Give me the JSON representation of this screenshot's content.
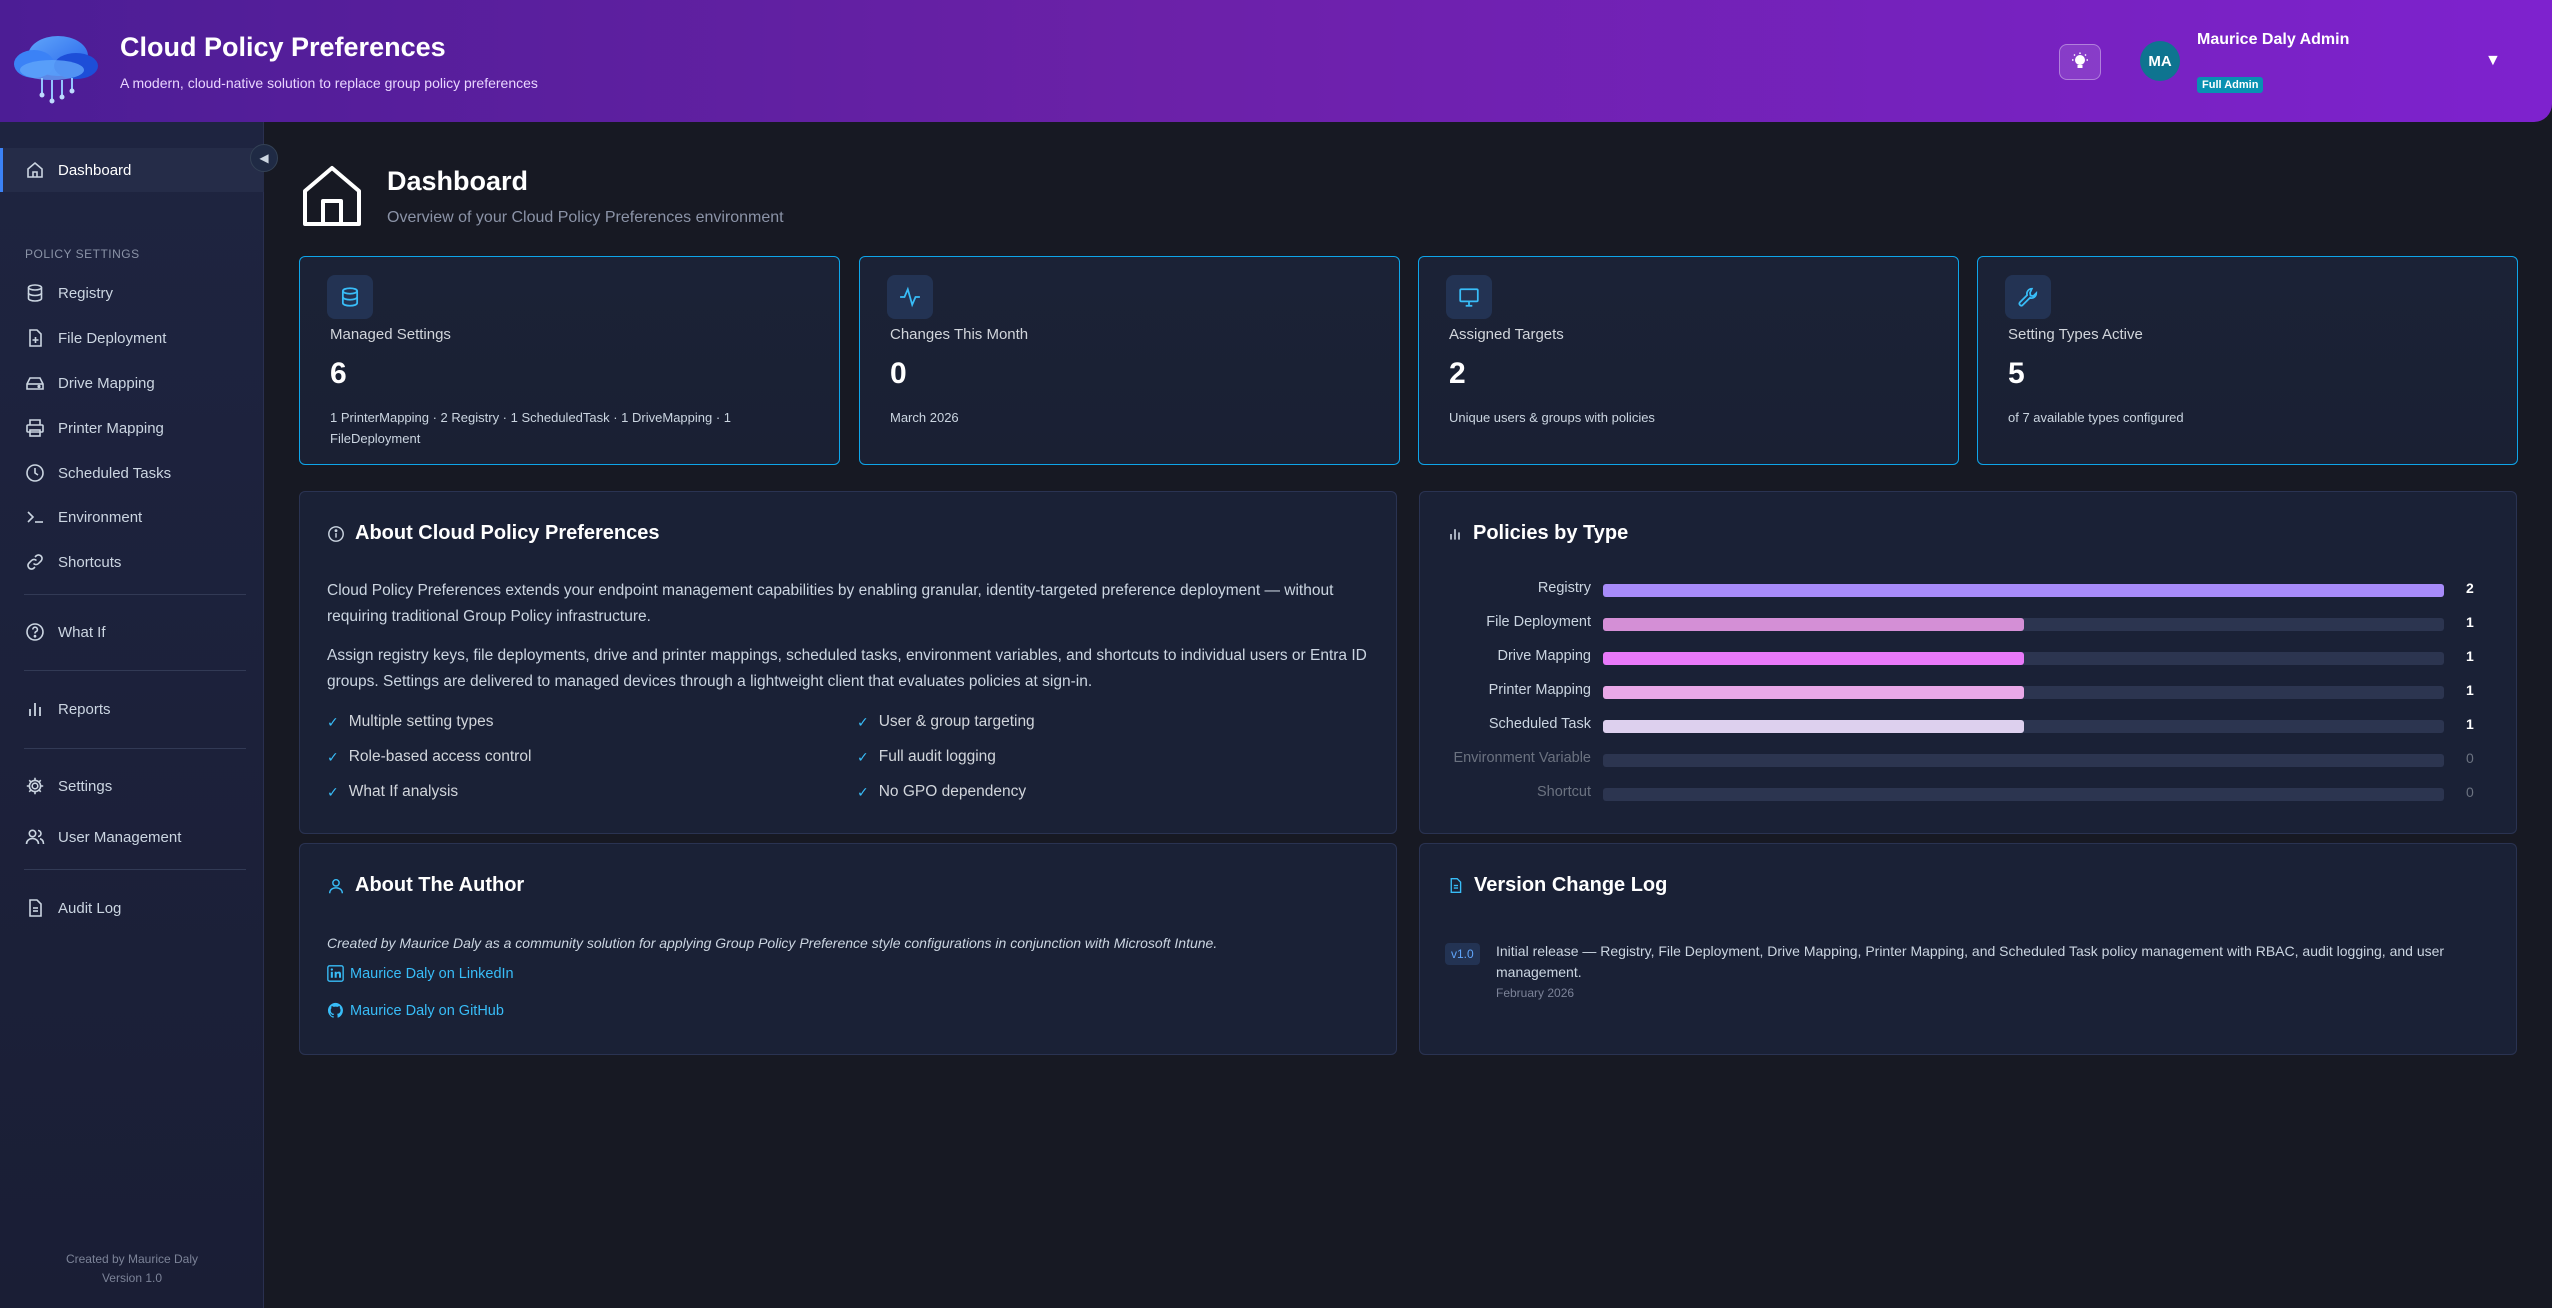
{
  "header": {
    "title": "Cloud Policy Preferences",
    "subtitle": "A modern, cloud-native solution to replace group policy preferences",
    "user_initials": "MA",
    "user_name": "Maurice Daly Admin",
    "user_role": "Full Admin"
  },
  "sidebar": {
    "dashboard": "Dashboard",
    "section_label": "POLICY SETTINGS",
    "items": [
      "Registry",
      "File Deployment",
      "Drive Mapping",
      "Printer Mapping",
      "Scheduled Tasks",
      "Environment",
      "Shortcuts"
    ],
    "what_if": "What If",
    "reports": "Reports",
    "settings": "Settings",
    "user_management": "User Management",
    "audit_log": "Audit Log",
    "footer_created": "Created by Maurice Daly",
    "footer_version": "Version 1.0"
  },
  "page": {
    "title": "Dashboard",
    "subtitle": "Overview of your Cloud Policy Preferences environment"
  },
  "stats": [
    {
      "label": "Managed Settings",
      "value": "6",
      "note": "1 PrinterMapping · 2 Registry · 1 ScheduledTask · 1 DriveMapping · 1 FileDeployment"
    },
    {
      "label": "Changes This Month",
      "value": "0",
      "note": "March 2026"
    },
    {
      "label": "Assigned Targets",
      "value": "2",
      "note": "Unique users & groups with policies"
    },
    {
      "label": "Setting Types Active",
      "value": "5",
      "note": "of 7 available types configured"
    }
  ],
  "about": {
    "title": "About Cloud Policy Preferences",
    "p1": "Cloud Policy Preferences extends your endpoint management capabilities by enabling granular, identity-targeted preference deployment — without requiring traditional Group Policy infrastructure.",
    "p2": "Assign registry keys, file deployments, drive and printer mappings, scheduled tasks, environment variables, and shortcuts to individual users or Entra ID groups. Settings are delivered to managed devices through a lightweight client that evaluates policies at sign-in.",
    "features": [
      "Multiple setting types",
      "User & group targeting",
      "Role-based access control",
      "Full audit logging",
      "What If analysis",
      "No GPO dependency"
    ]
  },
  "chart_data": {
    "type": "bar",
    "title": "Policies by Type",
    "orientation": "horizontal",
    "categories": [
      "Registry",
      "File Deployment",
      "Drive Mapping",
      "Printer Mapping",
      "Scheduled Task",
      "Environment Variable",
      "Shortcut"
    ],
    "values": [
      2,
      1,
      1,
      1,
      1,
      0,
      0
    ],
    "colors": [
      "#a78bfa",
      "#d48fd6",
      "#e879f9",
      "#e9a8e8",
      "#ddd0ee",
      "#2c3550",
      "#2c3550"
    ],
    "xlim": [
      0,
      2
    ]
  },
  "author": {
    "title": "About The Author",
    "text": "Created by Maurice Daly as a community solution for applying Group Policy Preference style configurations in conjunction with Microsoft Intune.",
    "linkedin": "Maurice Daly on LinkedIn",
    "github": "Maurice Daly on GitHub"
  },
  "changelog": {
    "title": "Version Change Log",
    "version": "v1.0",
    "text": "Initial release — Registry, File Deployment, Drive Mapping, Printer Mapping, and Scheduled Task policy management with RBAC, audit logging, and user management.",
    "date": "February 2026"
  }
}
